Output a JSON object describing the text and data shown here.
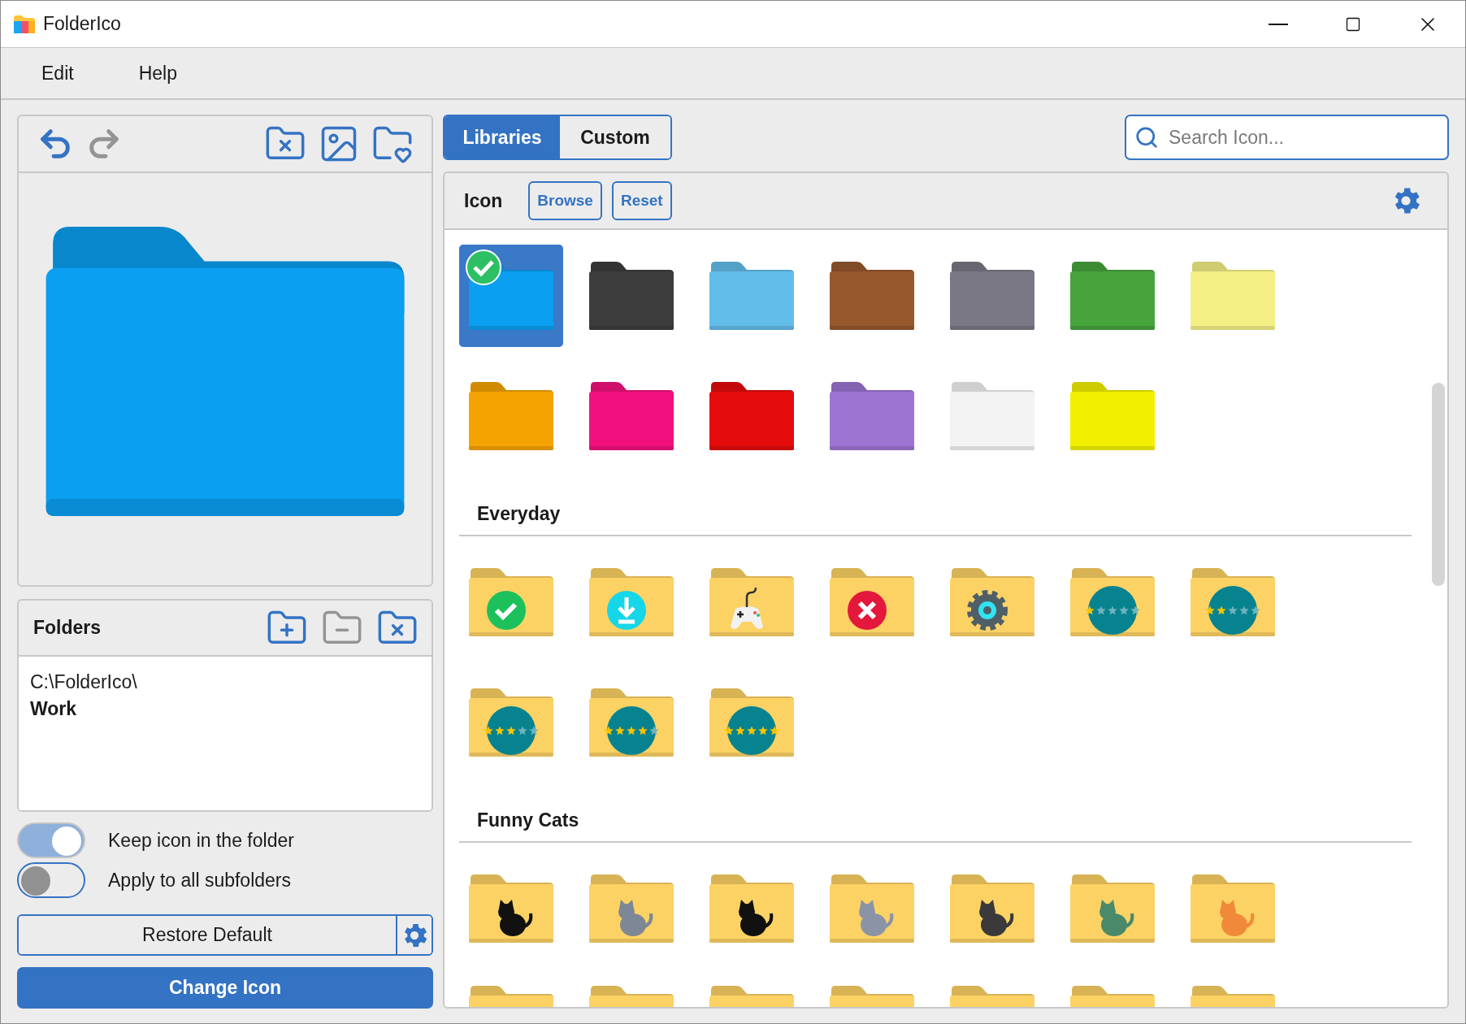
{
  "window": {
    "title": "FolderIco"
  },
  "menu": [
    {
      "label": "Edit"
    },
    {
      "label": "Help"
    }
  ],
  "toolbar": [
    {
      "kind": "undo",
      "disabled": false
    },
    {
      "kind": "redo",
      "disabled": true
    },
    {
      "kind": "folder-x",
      "disabled": false
    },
    {
      "kind": "image",
      "disabled": false
    },
    {
      "kind": "folder-heart",
      "disabled": false
    }
  ],
  "folders_panel": {
    "title": "Folders",
    "actions": [
      {
        "kind": "add",
        "disabled": false
      },
      {
        "kind": "remove",
        "disabled": true
      },
      {
        "kind": "clear",
        "disabled": false
      }
    ],
    "paths": [
      {
        "dir": "C:\\FolderIco\\",
        "name": "Work"
      }
    ]
  },
  "options": [
    {
      "label": "Keep icon in the folder",
      "on": true
    },
    {
      "label": "Apply to all subfolders",
      "on": false
    }
  ],
  "restore_button": "Restore Default",
  "change_button": "Change Icon",
  "tabs": [
    {
      "label": "Libraries",
      "selected": true
    },
    {
      "label": "Custom",
      "selected": false
    }
  ],
  "search": {
    "placeholder": "Search Icon..."
  },
  "icon_header": {
    "label": "Icon",
    "buttons": [
      "Browse",
      "Reset"
    ]
  },
  "sections": [
    {
      "items": [
        {
          "kind": "plain",
          "color": "#0a9ff0",
          "selected": true
        },
        {
          "kind": "plain",
          "color": "#3c3c3c",
          "selected": false
        },
        {
          "kind": "plain",
          "color": "#63bdea",
          "selected": false
        },
        {
          "kind": "plain",
          "color": "#97582e",
          "selected": false
        },
        {
          "kind": "plain",
          "color": "#7a7884",
          "selected": false
        },
        {
          "kind": "plain",
          "color": "#47a43c",
          "selected": false
        },
        {
          "kind": "plain",
          "color": "#f4f086",
          "selected": false
        },
        {
          "kind": "plain",
          "color": "#f5a300",
          "selected": false
        },
        {
          "kind": "plain",
          "color": "#f2107e",
          "selected": false
        },
        {
          "kind": "plain",
          "color": "#e40c0c",
          "selected": false
        },
        {
          "kind": "plain",
          "color": "#9d74d2",
          "selected": false
        },
        {
          "kind": "plain",
          "color": "#f3f3f3",
          "selected": false
        },
        {
          "kind": "plain",
          "color": "#f2f000",
          "selected": false
        }
      ]
    },
    {
      "title": "Everyday",
      "items": [
        {
          "kind": "check",
          "selected": false
        },
        {
          "kind": "download",
          "selected": false
        },
        {
          "kind": "gamepad",
          "selected": false
        },
        {
          "kind": "error",
          "selected": false
        },
        {
          "kind": "gear",
          "selected": false
        },
        {
          "kind": "rating",
          "stars": 1,
          "selected": false
        },
        {
          "kind": "rating",
          "stars": 2,
          "selected": false
        },
        {
          "kind": "rating",
          "stars": 3,
          "selected": false
        },
        {
          "kind": "rating",
          "stars": 4,
          "selected": false
        },
        {
          "kind": "rating",
          "stars": 5,
          "selected": false
        }
      ]
    },
    {
      "title": "Funny Cats",
      "items": [
        {
          "kind": "cat",
          "selected": false
        },
        {
          "kind": "cat",
          "selected": false
        },
        {
          "kind": "cat",
          "selected": false
        },
        {
          "kind": "cat",
          "selected": false
        },
        {
          "kind": "cat",
          "selected": false
        },
        {
          "kind": "cat",
          "selected": false
        },
        {
          "kind": "cat",
          "selected": false
        },
        {
          "kind": "edge",
          "selected": false
        },
        {
          "kind": "edge",
          "selected": false
        },
        {
          "kind": "edge",
          "selected": false
        },
        {
          "kind": "edge",
          "selected": false
        },
        {
          "kind": "edge",
          "selected": false
        },
        {
          "kind": "edge",
          "selected": false
        },
        {
          "kind": "edge",
          "selected": false
        }
      ]
    }
  ]
}
